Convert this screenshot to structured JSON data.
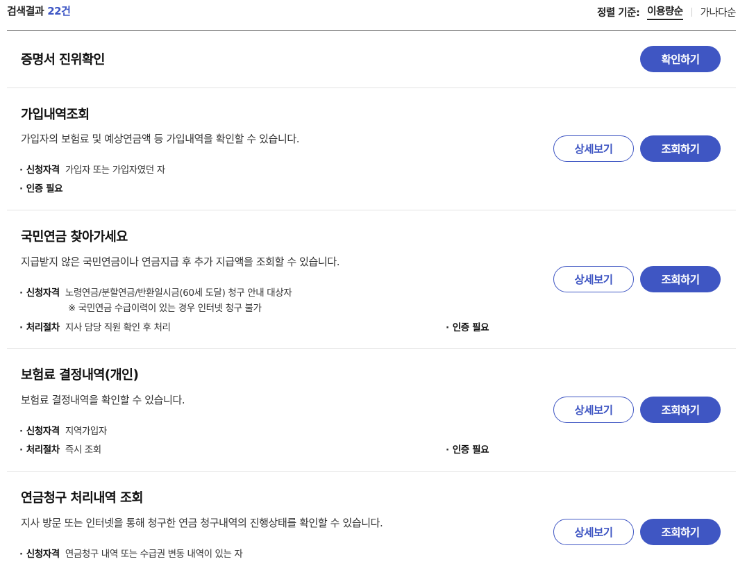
{
  "header": {
    "result_label": "검색결과",
    "result_count": "22건",
    "sort_label": "정렬 기준:",
    "sort_options": [
      "이용량순",
      "가나다순"
    ]
  },
  "items": [
    {
      "title": "증명서 진위확인",
      "primary_button": "확인하기"
    },
    {
      "title": "가입내역조회",
      "desc": "가입자의 보험료 및 예상연금액 등 가입내역을 확인할 수 있습니다.",
      "eligibility_key": "신청자격",
      "eligibility_value": "가입자 또는 가입자였던 자",
      "auth": "인증 필요",
      "detail_button": "상세보기",
      "primary_button": "조회하기"
    },
    {
      "title": "국민연금 찾아가세요",
      "desc": "지급받지 않은 국민연금이나 연금지급 후 추가 지급액을 조회할 수 있습니다.",
      "eligibility_key": "신청자격",
      "eligibility_value": "노령연금/분할연금/반환일시금(60세 도달) 청구 안내 대상자",
      "eligibility_note": "※ 국민연금 수급이력이 있는 경우 인터넷 청구 불가",
      "process_key": "처리절차",
      "process_value": "지사 담당 직원 확인 후 처리",
      "auth": "인증 필요",
      "detail_button": "상세보기",
      "primary_button": "조회하기"
    },
    {
      "title": "보험료 결정내역(개인)",
      "desc": "보험료 결정내역을 확인할 수 있습니다.",
      "eligibility_key": "신청자격",
      "eligibility_value": "지역가입자",
      "process_key": "처리절차",
      "process_value": "즉시 조회",
      "auth": "인증 필요",
      "detail_button": "상세보기",
      "primary_button": "조회하기"
    },
    {
      "title": "연금청구 처리내역 조회",
      "desc": "지사 방문 또는 인터넷을 통해 청구한 연금 청구내역의 진행상태를 확인할 수 있습니다.",
      "eligibility_key": "신청자격",
      "eligibility_value": "연금청구 내역 또는 수급권 변동 내역이 있는 자",
      "detail_button": "상세보기",
      "primary_button": "조회하기"
    }
  ]
}
